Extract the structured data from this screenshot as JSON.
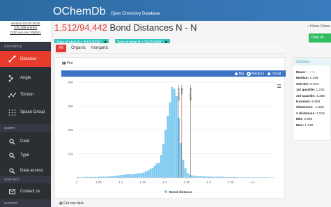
{
  "header": {
    "logo_main": "OChemDb",
    "logo_sub": "Open Chemistry Database"
  },
  "sidebar": {
    "version_lines": [
      "version 03-10-2016",
      "376,399 entries",
      "COD svn rev 206041"
    ],
    "sections": [
      {
        "label": "STATISTICS"
      },
      {
        "label": "QUERY"
      },
      {
        "label": "CONTACT"
      },
      {
        "label": "HISTORY"
      }
    ],
    "statistics_items": [
      {
        "label": "Distance",
        "icon": "distance-icon",
        "active": true
      },
      {
        "label": "Angle",
        "icon": "angle-icon",
        "active": false
      },
      {
        "label": "Torsion",
        "icon": "torsion-icon",
        "active": false
      },
      {
        "label": "Space Group",
        "icon": "space-group-icon",
        "active": false
      }
    ],
    "query_items": [
      {
        "label": "Card",
        "icon": "search-icon"
      },
      {
        "label": "Type",
        "icon": "search-icon"
      },
      {
        "label": "Data access",
        "icon": "search-icon"
      }
    ],
    "contact_items": [
      {
        "label": "Contact us",
        "icon": "mail-icon"
      }
    ]
  },
  "page": {
    "counter": "1,512/94,442",
    "title": " Bond Distances N - N",
    "chips": [
      {
        "label": "Type of atom A = 'N1/2/2/0/0'"
      },
      {
        "label": "Type of atom B = 'N1/2/2/0/0'"
      }
    ],
    "breadcrumb_home": "Home",
    "breadcrumb_current": "Distan",
    "clear_filters": "Clear all filters",
    "get_raw_data": "Get raw data"
  },
  "tabs": [
    {
      "label": "All",
      "active": true
    },
    {
      "label": "Organic",
      "active": false
    },
    {
      "label": "Inorganic",
      "active": false
    }
  ],
  "plot_panel": {
    "title": "Plot",
    "size_options": [
      {
        "label": "Big",
        "selected": false
      },
      {
        "label": "Medium",
        "selected": true
      },
      {
        "label": "Small",
        "selected": false
      }
    ]
  },
  "chart_data": {
    "type": "bar",
    "title": "",
    "xlabel": "",
    "ylabel": "",
    "xlim": [
      1.0,
      1.45
    ],
    "ylim": [
      0,
      400
    ],
    "x_ticks": [
      "1",
      "1.05",
      "1.1",
      "1.15",
      "1.2",
      "1.25",
      "1.3",
      "1.35",
      "1.4"
    ],
    "y_ticks": [
      "0",
      "100",
      "200",
      "300",
      "400"
    ],
    "bin_width": 0.005,
    "x": [
      1.0,
      1.005,
      1.01,
      1.015,
      1.02,
      1.025,
      1.03,
      1.035,
      1.04,
      1.045,
      1.05,
      1.055,
      1.06,
      1.065,
      1.07,
      1.075,
      1.08,
      1.085,
      1.09,
      1.095,
      1.1,
      1.105,
      1.11,
      1.115,
      1.12,
      1.125,
      1.13,
      1.135,
      1.14,
      1.145,
      1.15,
      1.155,
      1.16,
      1.165,
      1.17,
      1.175,
      1.18,
      1.185,
      1.19,
      1.195,
      1.2,
      1.205,
      1.21,
      1.215,
      1.22,
      1.225,
      1.23,
      1.235,
      1.24,
      1.245,
      1.25,
      1.255,
      1.26,
      1.265,
      1.27,
      1.275,
      1.28,
      1.285,
      1.29,
      1.295,
      1.3,
      1.305,
      1.31,
      1.315,
      1.32,
      1.325,
      1.33,
      1.335,
      1.34,
      1.345,
      1.35,
      1.355,
      1.36,
      1.365,
      1.37,
      1.375,
      1.38,
      1.385,
      1.39,
      1.395,
      1.4,
      1.405,
      1.41,
      1.415,
      1.42,
      1.425,
      1.43,
      1.435,
      1.44,
      1.445
    ],
    "values": [
      3,
      2,
      3,
      2,
      4,
      3,
      4,
      3,
      4,
      3,
      5,
      4,
      5,
      4,
      5,
      6,
      6,
      7,
      9,
      10,
      12,
      12,
      14,
      14,
      15,
      14,
      16,
      17,
      19,
      20,
      22,
      26,
      30,
      36,
      40,
      50,
      60,
      62,
      95,
      140,
      200,
      260,
      315,
      380,
      372,
      342,
      250,
      145,
      75,
      40,
      20,
      12,
      10,
      8,
      7,
      7,
      6,
      6,
      5,
      5,
      5,
      5,
      4,
      4,
      5,
      4,
      4,
      3,
      3,
      3,
      3,
      4,
      3,
      2,
      2,
      2,
      3,
      2,
      2,
      1,
      2,
      2,
      2,
      2,
      1,
      2,
      2,
      1,
      1,
      1
    ],
    "series": [
      {
        "name": "Bond distance",
        "color": "#7ecaf0"
      }
    ],
    "annotations": [
      {
        "label": "Mean",
        "x": 1.239
      },
      {
        "label": "1st quartile",
        "x": 1.232
      },
      {
        "label": "3rd quartile",
        "x": 1.259
      }
    ],
    "legend_position": "bottom-center",
    "grid": true
  },
  "statistics": {
    "header": "Statistics",
    "items": [
      {
        "label": "Mean:",
        "value": "1.239",
        "light": true
      },
      {
        "label": "Median:",
        "value": "1.249",
        "light": false
      },
      {
        "label": "Std dev:",
        "value": "0.043",
        "light": false
      },
      {
        "label": "1st quartile:",
        "value": "1.232",
        "light": false
      },
      {
        "label": "3rd quartile:",
        "value": "1.259",
        "light": false
      },
      {
        "label": "Kurtosis:",
        "value": "5.884",
        "light": false
      },
      {
        "label": "Skewness:",
        "value": "-1.555",
        "light": false
      },
      {
        "label": "# distances:",
        "value": "1,512",
        "light": false
      },
      {
        "label": "Min:",
        "value": "0.969",
        "light": false
      },
      {
        "label": "Max:",
        "value": "1.430",
        "light": false
      }
    ]
  }
}
